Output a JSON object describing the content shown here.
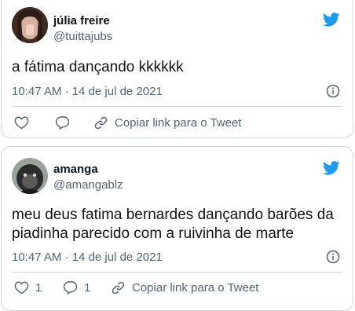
{
  "tweets": [
    {
      "author_name": "júlia freire",
      "handle": "@tuittajubs",
      "text": "a fátima dançando kkkkkk",
      "timestamp": "10:47 AM · 14 de jul de 2021",
      "likes": "",
      "replies": "",
      "copy_link_label": "Copiar link para o Tweet",
      "icons": [
        "twitter-bird-icon",
        "info-icon",
        "heart-icon",
        "reply-icon",
        "link-icon"
      ],
      "accent": "#1d9bf0"
    },
    {
      "author_name": "amanga",
      "handle": "@amangablz",
      "text_line1": "meu deus fatima bernardes dançando barões da",
      "text_line2": "piadinha parecido com a ruivinha de marte",
      "timestamp": "10:47 AM · 14 de jul de 2021",
      "likes": "1",
      "replies": "1",
      "copy_link_label": "Copiar link para o Tweet",
      "icons": [
        "twitter-bird-icon",
        "info-icon",
        "heart-icon",
        "reply-icon",
        "link-icon"
      ],
      "accent": "#1d9bf0"
    }
  ]
}
